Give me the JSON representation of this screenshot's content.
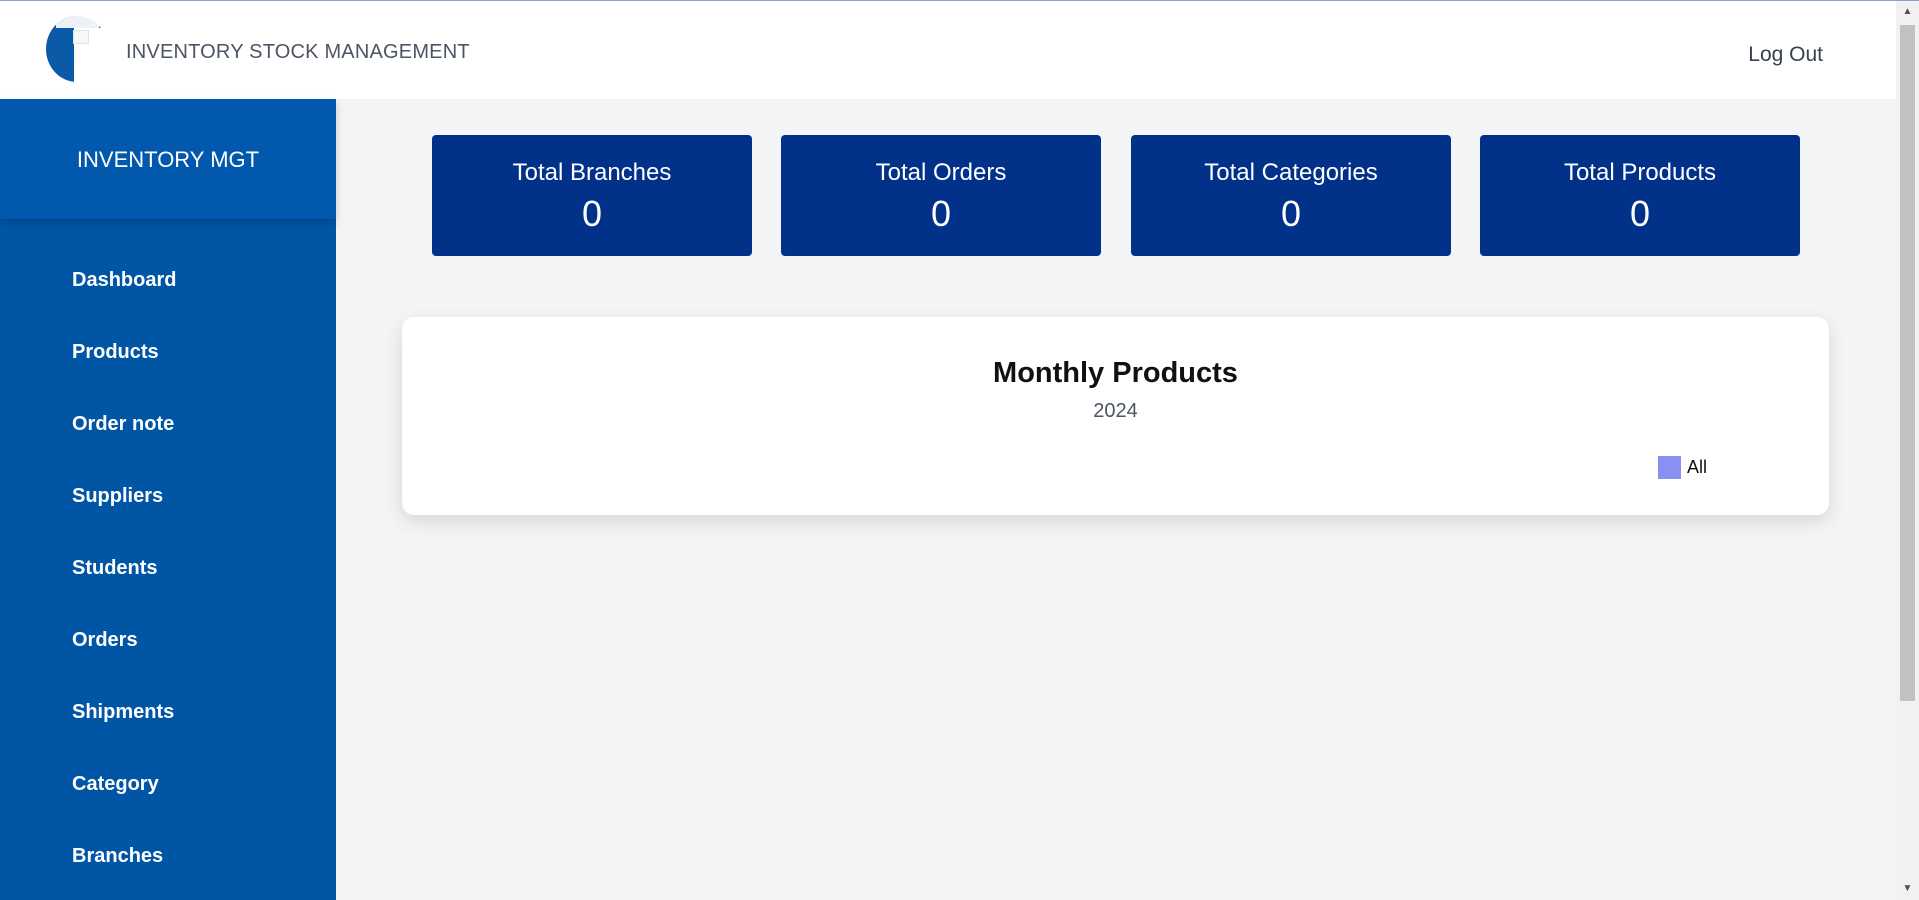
{
  "header": {
    "app_title": "INVENTORY STOCK MANAGEMENT",
    "logout_label": "Log Out"
  },
  "sidebar": {
    "brand": "INVENTORY MGT",
    "items": [
      {
        "label": "Dashboard"
      },
      {
        "label": "Products"
      },
      {
        "label": "Order note"
      },
      {
        "label": "Suppliers"
      },
      {
        "label": "Students"
      },
      {
        "label": "Orders"
      },
      {
        "label": "Shipments"
      },
      {
        "label": "Category"
      },
      {
        "label": "Branches"
      }
    ]
  },
  "stats": [
    {
      "label": "Total Branches",
      "value": "0"
    },
    {
      "label": "Total Orders",
      "value": "0"
    },
    {
      "label": "Total Categories",
      "value": "0"
    },
    {
      "label": "Total Products",
      "value": "0"
    }
  ],
  "colors": {
    "sidebar": "#0155a5",
    "stat_card": "#02318a",
    "legend_all": "#8a8ff2"
  },
  "chart_data": {
    "type": "bar",
    "title": "Monthly Products",
    "subtitle": "2024",
    "series": [
      {
        "name": "All",
        "values": []
      }
    ],
    "legend_position": "top-right"
  }
}
